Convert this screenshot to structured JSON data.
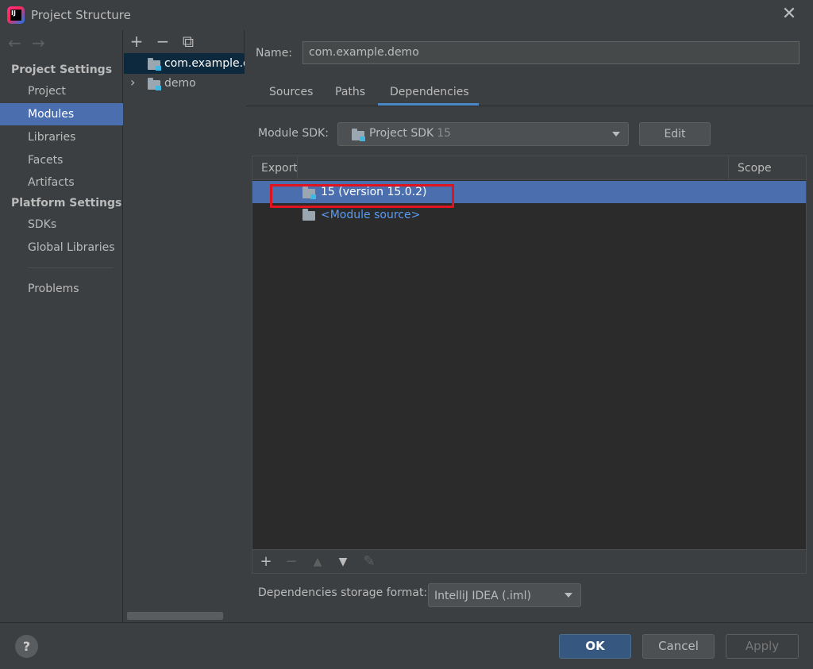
{
  "window": {
    "title": "Project Structure",
    "close_glyph": "✕"
  },
  "nav": {
    "back_glyph": "←",
    "forward_glyph": "→",
    "project_settings_header": "Project Settings",
    "platform_settings_header": "Platform Settings",
    "items": [
      {
        "label": "Project"
      },
      {
        "label": "Modules",
        "selected": true
      },
      {
        "label": "Libraries"
      },
      {
        "label": "Facets"
      },
      {
        "label": "Artifacts"
      },
      {
        "label": "SDKs"
      },
      {
        "label": "Global Libraries"
      },
      {
        "label": "Problems"
      }
    ]
  },
  "tree": {
    "toolbar": {
      "add": "+",
      "remove": "−",
      "copy": "⧉"
    },
    "rows": [
      {
        "label": "com.example.demo",
        "selected": true
      },
      {
        "label": "demo",
        "expander": "›"
      }
    ]
  },
  "module": {
    "name_label": "Name:",
    "name_value": "com.example.demo",
    "tabs": [
      {
        "label": "Sources"
      },
      {
        "label": "Paths"
      },
      {
        "label": "Dependencies",
        "active": true
      }
    ],
    "sdk_label": "Module SDK:",
    "sdk_value": "Project SDK",
    "sdk_version": "15",
    "edit_label": "Edit"
  },
  "dependencies": {
    "columns": {
      "export": "Export",
      "scope": "Scope"
    },
    "rows": [
      {
        "label": "15 (version 15.0.2)",
        "selected": true
      },
      {
        "label": "<Module source>"
      }
    ],
    "toolbar": {
      "add": "+",
      "remove": "−",
      "up": "▲",
      "down": "▼",
      "edit": "✎"
    },
    "storage_label": "Dependencies storage format:",
    "storage_value": "IntelliJ IDEA (.iml)"
  },
  "buttons": {
    "help": "?",
    "ok": "OK",
    "cancel": "Cancel",
    "apply": "Apply"
  },
  "colors": {
    "selection": "#4b6eaf",
    "highlight_box": "#e0141e",
    "link": "#589df6",
    "ok_button": "#365880"
  }
}
